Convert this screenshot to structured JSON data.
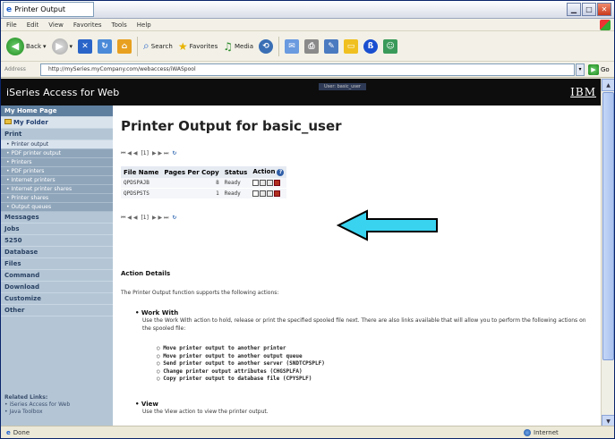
{
  "window": {
    "title": "Printer Output"
  },
  "menu": [
    "File",
    "Edit",
    "View",
    "Favorites",
    "Tools",
    "Help"
  ],
  "toolbar": {
    "back": "Back",
    "search": "Search",
    "favorites": "Favorites",
    "media": "Media"
  },
  "address": {
    "label": "Address",
    "url": "http://mySeries.myCompany.com/webaccess/iWASpool",
    "go": "Go"
  },
  "banner": {
    "title": "iSeries Access for Web",
    "user": "User: basic_user",
    "logo": "IBM"
  },
  "sidebar": {
    "top": [
      "My Home Page",
      "My Folder"
    ],
    "print_header": "Print",
    "print_items": [
      "Printer output",
      "PDF printer output",
      "Printers",
      "PDF printers",
      "Internet printers",
      "Internet printer shares",
      "Printer shares",
      "Output queues"
    ],
    "sections": [
      "Messages",
      "Jobs",
      "5250",
      "Database",
      "Files",
      "Command",
      "Download",
      "Customize",
      "Other"
    ],
    "related_title": "Related Links:",
    "related_items": [
      "iSeries Access for Web",
      "Java Toolbox"
    ]
  },
  "main": {
    "title": "Printer Output for basic_user",
    "pager_top": {
      "nav": "⏮ ◀ ◀",
      "page": "[1]",
      "nav2": "▶ ▶ ⏭",
      "refresh": "↻"
    },
    "table": {
      "headers": [
        "File Name",
        "Pages Per Copy",
        "Status",
        "Action"
      ],
      "rows": [
        {
          "file": "QPDSPAJB",
          "pages": "8",
          "status": "Ready"
        },
        {
          "file": "QPDSPSTS",
          "pages": "1",
          "status": "Ready"
        }
      ]
    },
    "action_details": "Action Details",
    "intro": "The Printer Output function supports the following actions:",
    "work_with": {
      "title": "Work With",
      "text": "Use the Work With action to hold, release or print the specified spooled file next. There are also links available that will allow you to perform the following actions on the spooled file:"
    },
    "sub_actions": [
      "Move printer output to another printer",
      "Move printer output to another output queue",
      "Send printer output to another server (SNDTCPSPLF)",
      "Change printer output attributes (CHGSPLFA)",
      "Copy printer output to database file (CPYSPLF)"
    ],
    "view": {
      "title": "View",
      "text": "Use the View action to view the printer output."
    }
  },
  "status": {
    "left": "Done",
    "zone": "Internet"
  },
  "colors": {
    "banner": "#0d0d0d",
    "sidebar": "#b4c6d6",
    "arrow": "#39d3f0"
  }
}
